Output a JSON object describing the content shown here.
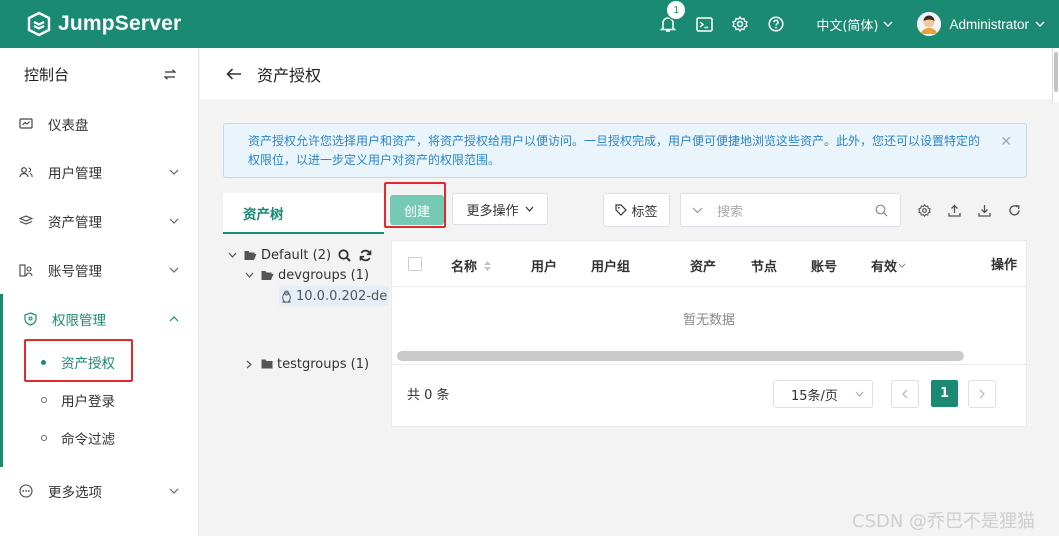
{
  "app": {
    "name": "JumpServer",
    "brand_color": "#1a8a72"
  },
  "topbar": {
    "notification_count": "1",
    "icons": [
      "bell-icon",
      "terminal-icon",
      "gear-icon",
      "help-icon"
    ],
    "language": "中文(简体)",
    "user": "Administrator"
  },
  "sidebar": {
    "title": "控制台",
    "items": [
      {
        "label": "仪表盘",
        "icon": "dashboard-icon"
      },
      {
        "label": "用户管理",
        "icon": "users-icon"
      },
      {
        "label": "资产管理",
        "icon": "assets-icon"
      },
      {
        "label": "账号管理",
        "icon": "accounts-icon"
      },
      {
        "label": "权限管理",
        "icon": "shield-icon",
        "expanded": true
      },
      {
        "label": "更多选项",
        "icon": "more-icon"
      }
    ],
    "sub_items": [
      {
        "label": "资产授权",
        "active": true
      },
      {
        "label": "用户登录"
      },
      {
        "label": "命令过滤"
      }
    ]
  },
  "page": {
    "title": "资产授权"
  },
  "alert": {
    "text": "资产授权允许您选择用户和资产，将资产授权给用户以便访问。一旦授权完成，用户便可便捷地浏览这些资产。此外，您还可以设置特定的权限位，以进一步定义用户对资产的权限范围。"
  },
  "tree": {
    "tab_label": "资产树",
    "nodes": [
      {
        "label": "Default (2)",
        "level": 0,
        "expanded": true
      },
      {
        "label": "devgroups (1)",
        "level": 1,
        "expanded": true
      },
      {
        "label": "10.0.0.202-de",
        "level": 2,
        "selected": true
      },
      {
        "label": "testgroups (1)",
        "level": 1,
        "expanded": false
      }
    ]
  },
  "toolbar": {
    "create_label": "创建",
    "more_label": "更多操作",
    "tag_label": "标签",
    "search_placeholder": "搜索"
  },
  "table": {
    "columns": [
      "名称",
      "用户",
      "用户组",
      "资产",
      "节点",
      "账号",
      "有效",
      "操作"
    ],
    "empty_text": "暂无数据"
  },
  "pagination": {
    "total_text": "共 0 条",
    "page_size": "15条/页",
    "current_page": "1"
  },
  "watermark": "CSDN @乔巴不是狸猫"
}
